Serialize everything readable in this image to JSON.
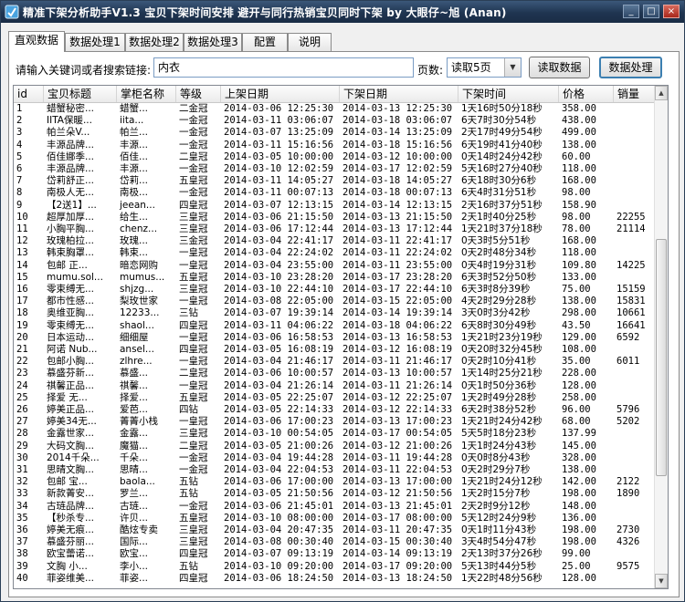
{
  "window": {
    "title": "精准下架分析助手V1.3 宝贝下架时间安排 避开与同行热销宝贝同时下架 by 大眼仔~旭 (Anan)",
    "controls": [
      "_",
      "□",
      "×"
    ]
  },
  "tabs": [
    "直观数据",
    "数据处理1",
    "数据处理2",
    "数据处理3",
    "配置",
    "说明"
  ],
  "search": {
    "label": "请输入关键词或者搜索链接:",
    "value": "内衣"
  },
  "pages": {
    "label": "页数:",
    "selected": "读取5页"
  },
  "buttons": {
    "read": "读取数据",
    "process": "数据处理"
  },
  "table": {
    "columns": [
      "id",
      "宝贝标题",
      "掌柜名称",
      "等级",
      "上架日期",
      "下架日期",
      "下架时间",
      "价格",
      "销量"
    ],
    "rows": [
      [
        "1",
        "蜡蟹秘密...",
        "蜡蟹...",
        "二金冠",
        "2014-03-06 12:25:30",
        "2014-03-13 12:25:30",
        "1天16时50分18秒",
        "358.00",
        ""
      ],
      [
        "2",
        "IITA保暖...",
        "iita...",
        "一金冠",
        "2014-03-11 03:06:07",
        "2014-03-18 03:06:07",
        "6天7时30分54秒",
        "438.00",
        ""
      ],
      [
        "3",
        "帕兰朵V...",
        "帕兰...",
        "一金冠",
        "2014-03-07 13:25:09",
        "2014-03-14 13:25:09",
        "2天17时49分54秒",
        "499.00",
        ""
      ],
      [
        "4",
        "丰源品牌...",
        "丰源...",
        "一金冠",
        "2014-03-11 15:16:56",
        "2014-03-18 15:16:56",
        "6天19时41分40秒",
        "138.00",
        ""
      ],
      [
        "5",
        "佰佳娜季...",
        "佰佳...",
        "二皇冠",
        "2014-03-05 10:00:00",
        "2014-03-12 10:00:00",
        "0天14时24分42秒",
        "60.00",
        ""
      ],
      [
        "6",
        "丰源品牌...",
        "丰源...",
        "一金冠",
        "2014-03-10 12:02:59",
        "2014-03-17 12:02:59",
        "5天16时27分40秒",
        "118.00",
        ""
      ],
      [
        "7",
        "岱莉舒正...",
        "岱莉...",
        "五皇冠",
        "2014-03-11 14:05:27",
        "2014-03-18 14:05:27",
        "6天18时30分6秒",
        "168.00",
        ""
      ],
      [
        "8",
        "南极人无...",
        "南极...",
        "一金冠",
        "2014-03-11 00:07:13",
        "2014-03-18 00:07:13",
        "6天4时31分51秒",
        "98.00",
        ""
      ],
      [
        "9",
        "【2送1】...",
        "jeean...",
        "四皇冠",
        "2014-03-07 12:13:15",
        "2014-03-14 12:13:15",
        "2天16时37分51秒",
        "158.90",
        ""
      ],
      [
        "10",
        "超厚加厚...",
        "给生...",
        "三皇冠",
        "2014-03-06 21:15:50",
        "2014-03-13 21:15:50",
        "2天1时40分25秒",
        "98.00",
        "22255"
      ],
      [
        "11",
        "小胸平胸...",
        "chenz...",
        "三皇冠",
        "2014-03-06 17:12:44",
        "2014-03-13 17:12:44",
        "1天21时37分18秒",
        "78.00",
        "21114"
      ],
      [
        "12",
        "玫瑰柏拉...",
        "玫瑰...",
        "三金冠",
        "2014-03-04 22:41:17",
        "2014-03-11 22:41:17",
        "0天3时5分51秒",
        "168.00",
        ""
      ],
      [
        "13",
        "韩束胸罩...",
        "韩束...",
        "一皇冠",
        "2014-03-04 22:24:02",
        "2014-03-11 22:24:02",
        "0天2时48分34秒",
        "118.00",
        ""
      ],
      [
        "14",
        "包邮 正...",
        "暗恋网购",
        "一皇冠",
        "2014-03-04 23:55:00",
        "2014-03-11 23:55:00",
        "0天4时19分31秒",
        "109.80",
        "14225"
      ],
      [
        "15",
        "mumu.sol...",
        "mumus...",
        "五皇冠",
        "2014-03-10 23:28:20",
        "2014-03-17 23:28:20",
        "6天3时52分50秒",
        "133.00",
        ""
      ],
      [
        "16",
        "零束缚无...",
        "shjzg...",
        "三皇冠",
        "2014-03-10 22:44:10",
        "2014-03-17 22:44:10",
        "6天3时8分39秒",
        "75.00",
        "15159"
      ],
      [
        "17",
        "都市性感...",
        "梨玫世家",
        "一皇冠",
        "2014-03-08 22:05:00",
        "2014-03-15 22:05:00",
        "4天2时29分28秒",
        "138.00",
        "15831"
      ],
      [
        "18",
        "奥维亚胸...",
        "12233...",
        "三钻",
        "2014-03-07 19:39:14",
        "2014-03-14 19:39:14",
        "3天0时3分42秒",
        "298.00",
        "10661"
      ],
      [
        "19",
        "零束缚无...",
        "shaol...",
        "四皇冠",
        "2014-03-11 04:06:22",
        "2014-03-18 04:06:22",
        "6天8时30分49秒",
        "43.50",
        "16641"
      ],
      [
        "20",
        "日本运动...",
        "细细屋",
        "一皇冠",
        "2014-03-06 16:58:53",
        "2014-03-13 16:58:53",
        "1天21时23分19秒",
        "129.00",
        "6592"
      ],
      [
        "21",
        "阿诺 Nub...",
        "ansel...",
        "四皇冠",
        "2014-03-05 16:08:19",
        "2014-03-12 16:08:19",
        "0天20时32分45秒",
        "108.00",
        ""
      ],
      [
        "22",
        "包邮小胸...",
        "zlhre...",
        "一皇冠",
        "2014-03-04 21:46:17",
        "2014-03-11 21:46:17",
        "0天2时10分41秒",
        "35.00",
        "6011"
      ],
      [
        "23",
        "慕盛芬新...",
        "慕盛...",
        "二皇冠",
        "2014-03-06 10:00:57",
        "2014-03-13 10:00:57",
        "1天14时25分21秒",
        "228.00",
        ""
      ],
      [
        "24",
        "祺馨正品...",
        "祺馨...",
        "一皇冠",
        "2014-03-04 21:26:14",
        "2014-03-11 21:26:14",
        "0天1时50分36秒",
        "128.00",
        ""
      ],
      [
        "25",
        "择爱 无...",
        "择爱...",
        "五皇冠",
        "2014-03-05 22:25:07",
        "2014-03-12 22:25:07",
        "1天2时49分28秒",
        "258.00",
        ""
      ],
      [
        "26",
        "婷美正品...",
        "爱芭...",
        "四钻",
        "2014-03-05 22:14:33",
        "2014-03-12 22:14:33",
        "6天2时38分52秒",
        "96.00",
        "5796"
      ],
      [
        "27",
        "婷美34无...",
        "菁菁小栈",
        "一皇冠",
        "2014-03-06 17:00:23",
        "2014-03-13 17:00:23",
        "1天21时24分42秒",
        "68.00",
        "5202"
      ],
      [
        "28",
        "金露世家...",
        "金露...",
        "三皇冠",
        "2014-03-10 00:54:05",
        "2014-03-17 00:54:05",
        "5天5时18分23秒",
        "137.99",
        ""
      ],
      [
        "29",
        "大码文胸...",
        "魔猫...",
        "二皇冠",
        "2014-03-05 21:00:26",
        "2014-03-12 21:00:26",
        "1天1时24分43秒",
        "145.00",
        ""
      ],
      [
        "30",
        "2014千朵...",
        "千朵...",
        "一金冠",
        "2014-03-04 19:44:28",
        "2014-03-11 19:44:28",
        "0天0时8分43秒",
        "328.00",
        ""
      ],
      [
        "31",
        "思晴文胸...",
        "思晴...",
        "一金冠",
        "2014-03-04 22:04:53",
        "2014-03-11 22:04:53",
        "0天2时29分7秒",
        "138.00",
        ""
      ],
      [
        "32",
        "包邮 宝...",
        "baola...",
        "五钻",
        "2014-03-06 17:00:00",
        "2014-03-13 17:00:00",
        "1天21时24分12秒",
        "142.00",
        "2122"
      ],
      [
        "33",
        "新款菁安...",
        "罗兰...",
        "五钻",
        "2014-03-05 21:50:56",
        "2014-03-12 21:50:56",
        "1天2时15分7秒",
        "198.00",
        "1890"
      ],
      [
        "34",
        "古琏品牌...",
        "古琏...",
        "一金冠",
        "2014-03-06 21:45:01",
        "2014-03-13 21:45:01",
        "2天2时9分12秒",
        "148.00",
        ""
      ],
      [
        "35",
        "【秒杀专...",
        "许贝...",
        "五皇冠",
        "2014-03-10 08:00:00",
        "2014-03-17 08:00:00",
        "5天12时24分9秒",
        "136.00",
        ""
      ],
      [
        "36",
        "婷美无痕...",
        "酷炫专卖",
        "三皇冠",
        "2014-03-04 20:47:35",
        "2014-03-11 20:47:35",
        "0天1时11分43秒",
        "198.00",
        "2730"
      ],
      [
        "37",
        "慕盛芬丽...",
        "国际...",
        "三皇冠",
        "2014-03-08 00:30:40",
        "2014-03-15 00:30:40",
        "3天4时54分47秒",
        "198.00",
        "4326"
      ],
      [
        "38",
        "欧宝蕾诺...",
        "欧宝...",
        "四皇冠",
        "2014-03-07 09:13:19",
        "2014-03-14 09:13:19",
        "2天13时37分26秒",
        "99.00",
        ""
      ],
      [
        "39",
        "文胸 小...",
        "李小...",
        "五钻",
        "2014-03-10 09:20:00",
        "2014-03-17 09:20:00",
        "5天13时44分5秒",
        "25.00",
        "9575"
      ],
      [
        "40",
        "菲姿维美...",
        "菲姿...",
        "四皇冠",
        "2014-03-06 18:24:50",
        "2014-03-13 18:24:50",
        "1天22时48分56秒",
        "128.00",
        ""
      ]
    ]
  }
}
